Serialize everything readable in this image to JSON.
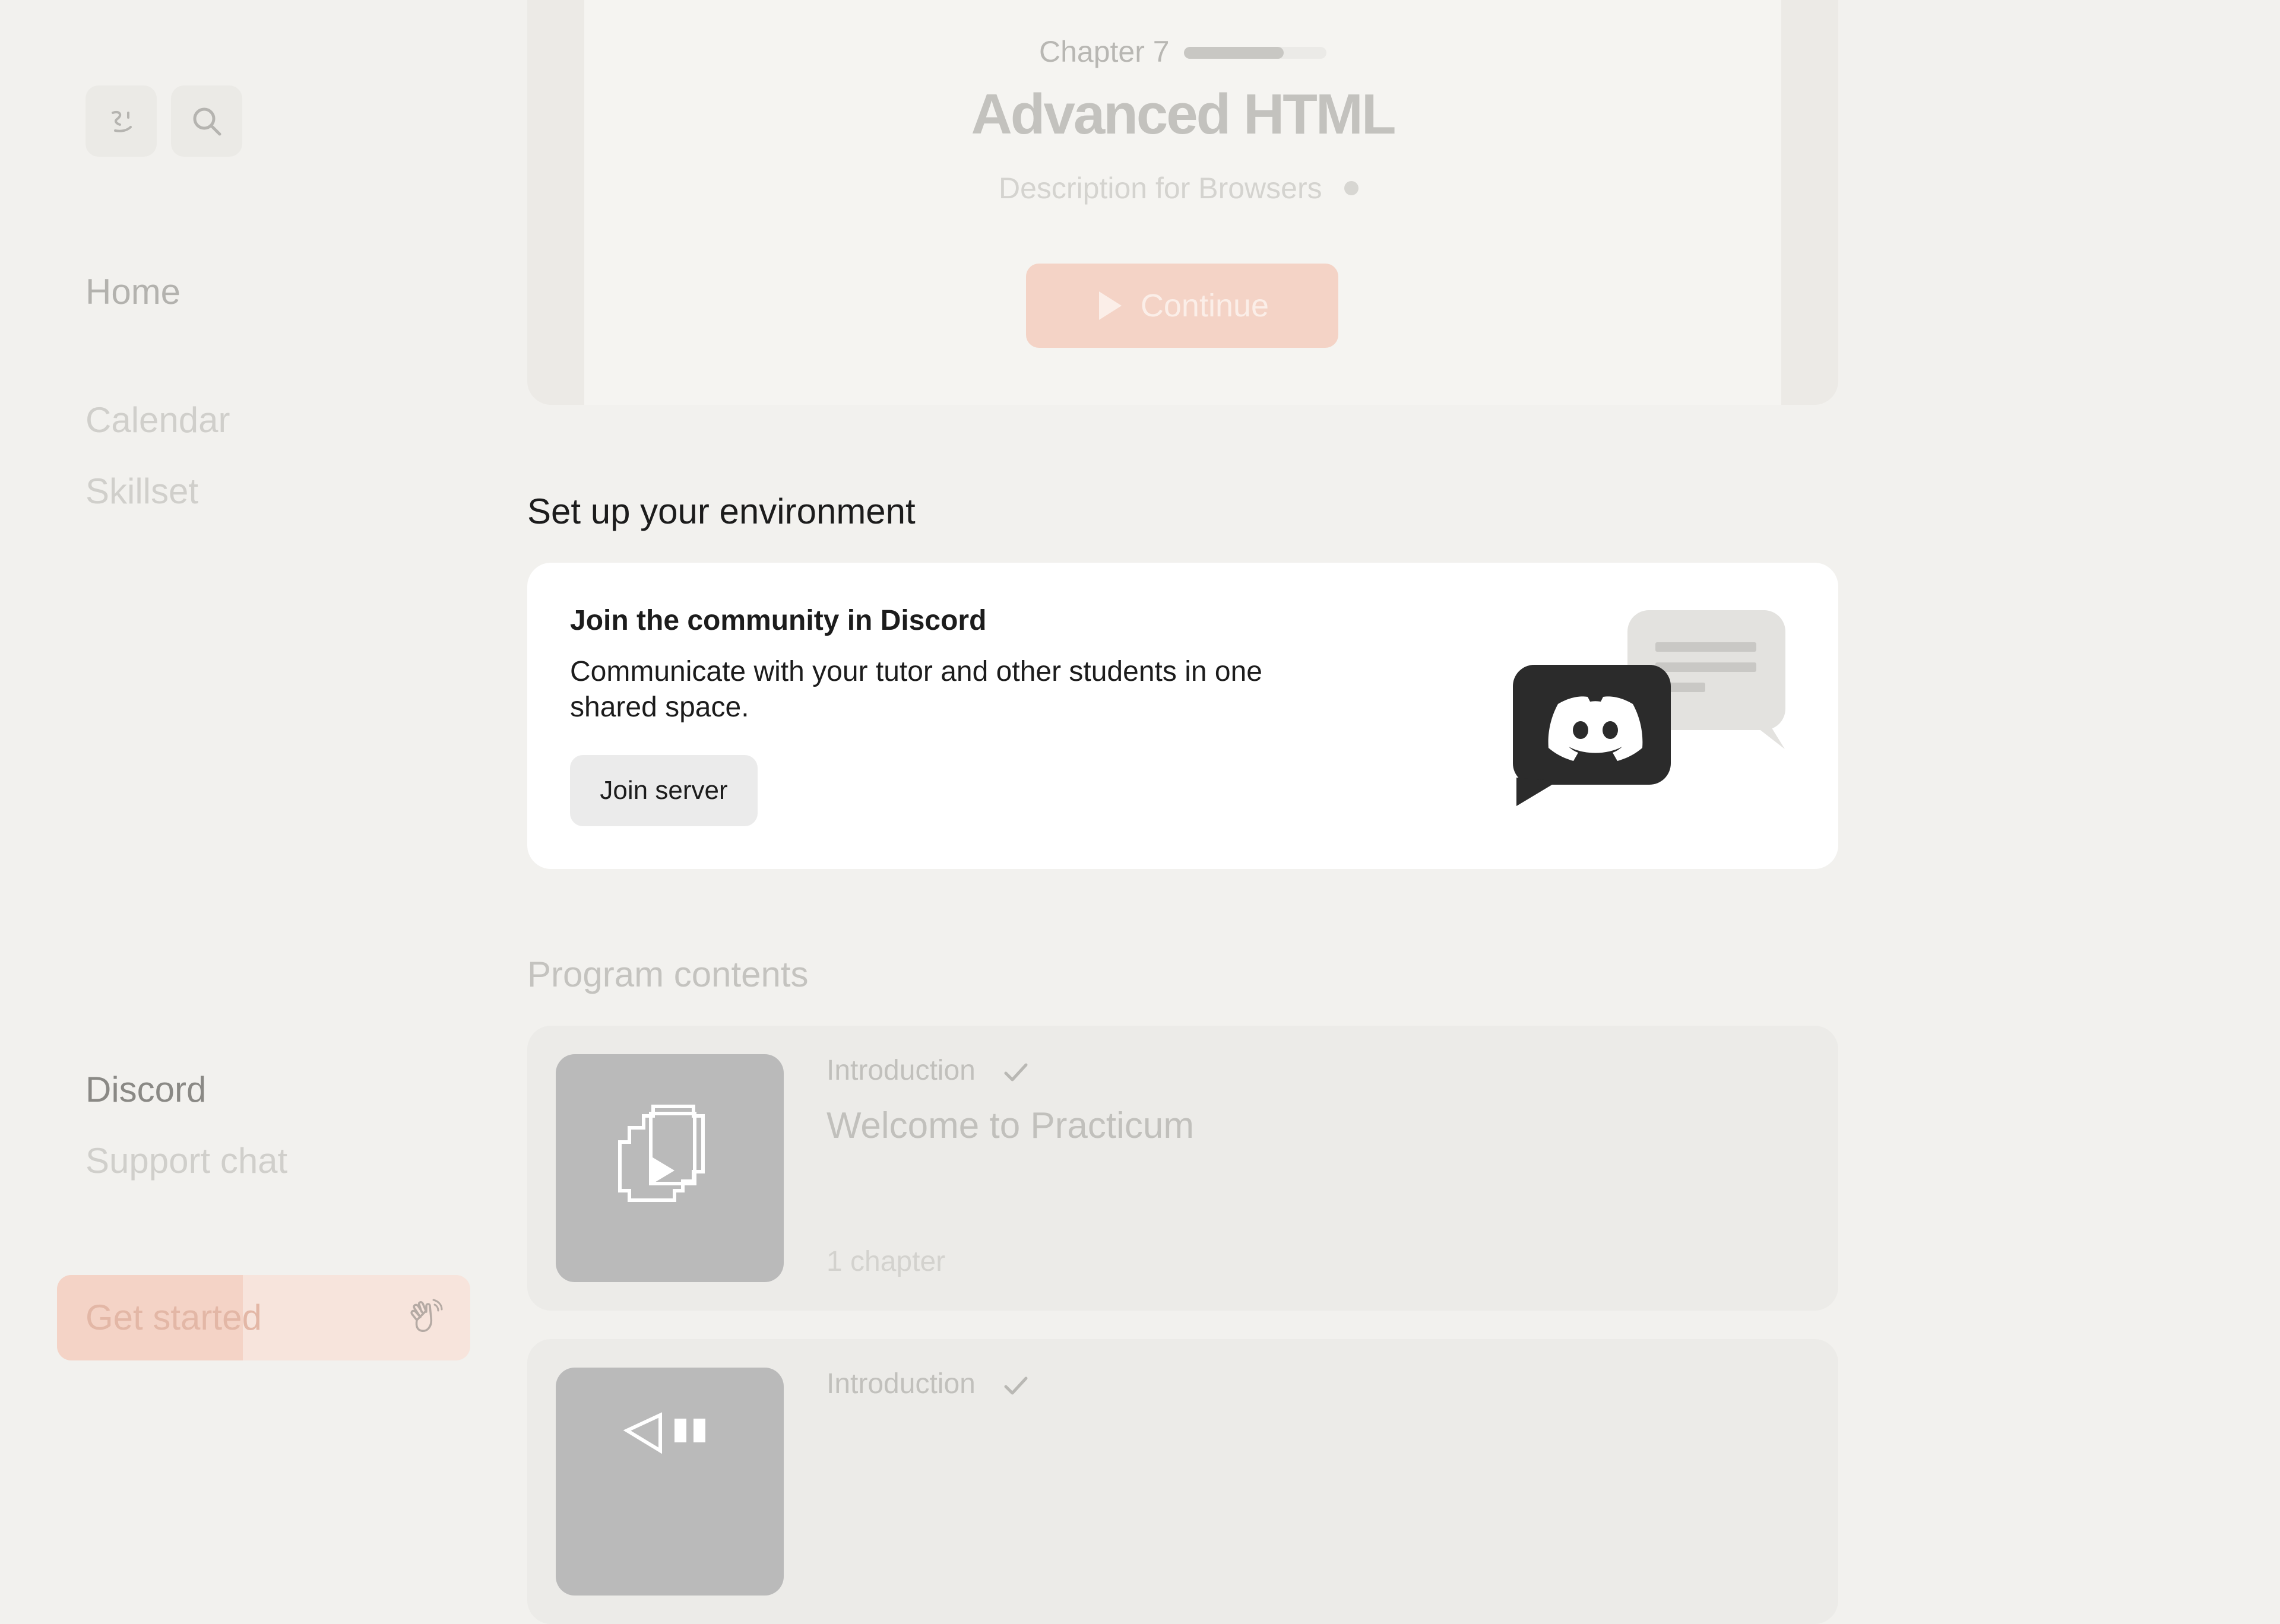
{
  "sidebar": {
    "top_icons": [
      "smile-icon",
      "search-icon"
    ],
    "nav_primary": [
      "Home"
    ],
    "nav_secondary": [
      "Calendar",
      "Skillset"
    ],
    "nav_bottom": [
      "Discord",
      "Support chat"
    ],
    "get_started": {
      "label": "Get started",
      "icon": "waving-hand-icon",
      "progress": 0.45
    }
  },
  "chapter": {
    "label": "Chapter 7",
    "progress": 0.7,
    "title": "Advanced HTML",
    "description": "Description for Browsers",
    "continue_label": "Continue"
  },
  "environment": {
    "section_title": "Set up your environment",
    "discord_title": "Join the community in Discord",
    "discord_desc": "Communicate with your tutor and other students in one shared space.",
    "join_label": "Join server"
  },
  "program": {
    "section_title": "Program contents",
    "courses": [
      {
        "tag": "Introduction",
        "name": "Welcome to Practicum",
        "meta": "1 chapter",
        "completed": true
      },
      {
        "tag": "Introduction",
        "name": "",
        "meta": "",
        "completed": true
      }
    ]
  },
  "colors": {
    "background": "#f2f1ee",
    "accent": "#f4d3c6",
    "discord": "#2b2b2b"
  }
}
